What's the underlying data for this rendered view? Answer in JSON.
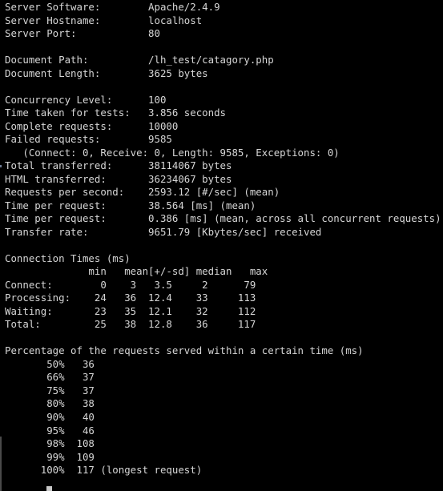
{
  "terminal": {
    "app": "Apache Bench (ab) output",
    "background_color": "#000000",
    "foreground_color": "#d6d6d6",
    "cursor_color": "#c8c8c8",
    "scrollbar_color": "#4a4a4a",
    "columns": 80,
    "rows": 37
  },
  "report": {
    "server": {
      "lines": [
        {
          "label": "Server Software:",
          "value": "Apache/2.4.9"
        },
        {
          "label": "Server Hostname:",
          "value": "localhost"
        },
        {
          "label": "Server Port:",
          "value": "80"
        }
      ]
    },
    "document": {
      "lines": [
        {
          "label": "Document Path:",
          "value": "/lh_test/catagory.php"
        },
        {
          "label": "Document Length:",
          "value": "3625 bytes"
        }
      ]
    },
    "results": {
      "lines": [
        {
          "label": "Concurrency Level:",
          "value": "100"
        },
        {
          "label": "Time taken for tests:",
          "value": "3.856 seconds"
        },
        {
          "label": "Complete requests:",
          "value": "10000"
        },
        {
          "label": "Failed requests:",
          "value": "9585"
        }
      ],
      "failed_detail": "   (Connect: 0, Receive: 0, Length: 9585, Exceptions: 0)",
      "lines2": [
        {
          "label": "Total transferred:",
          "value": "38114067 bytes"
        },
        {
          "label": "HTML transferred:",
          "value": "36234067 bytes"
        },
        {
          "label": "Requests per second:",
          "value": "2593.12 [#/sec] (mean)"
        },
        {
          "label": "Time per request:",
          "value": "38.564 [ms] (mean)"
        },
        {
          "label": "Time per request:",
          "value": "0.386 [ms] (mean, across all concurrent requests)"
        },
        {
          "label": "Transfer rate:",
          "value": "9651.79 [Kbytes/sec] received"
        }
      ]
    },
    "connection_times": {
      "title": "Connection Times (ms)",
      "headers": [
        "",
        "min",
        "mean[+/-sd]",
        "median",
        "max"
      ],
      "rows": [
        {
          "label": "Connect:",
          "min": "0",
          "mean": "3",
          "sd": "3.5",
          "median": "2",
          "max": "79"
        },
        {
          "label": "Processing:",
          "min": "24",
          "mean": "36",
          "sd": "12.4",
          "median": "33",
          "max": "113"
        },
        {
          "label": "Waiting:",
          "min": "23",
          "mean": "35",
          "sd": "12.1",
          "median": "32",
          "max": "112"
        },
        {
          "label": "Total:",
          "min": "25",
          "mean": "38",
          "sd": "12.8",
          "median": "36",
          "max": "117"
        }
      ]
    },
    "percentiles": {
      "title": "Percentage of the requests served within a certain time (ms)",
      "rows": [
        {
          "percent": "50%",
          "value": "36",
          "note": ""
        },
        {
          "percent": "66%",
          "value": "37",
          "note": ""
        },
        {
          "percent": "75%",
          "value": "37",
          "note": ""
        },
        {
          "percent": "80%",
          "value": "38",
          "note": ""
        },
        {
          "percent": "90%",
          "value": "40",
          "note": ""
        },
        {
          "percent": "95%",
          "value": "46",
          "note": ""
        },
        {
          "percent": "98%",
          "value": "108",
          "note": ""
        },
        {
          "percent": "99%",
          "value": "109",
          "note": ""
        },
        {
          "percent": "100%",
          "value": "117",
          "note": "(longest request)"
        }
      ]
    }
  }
}
